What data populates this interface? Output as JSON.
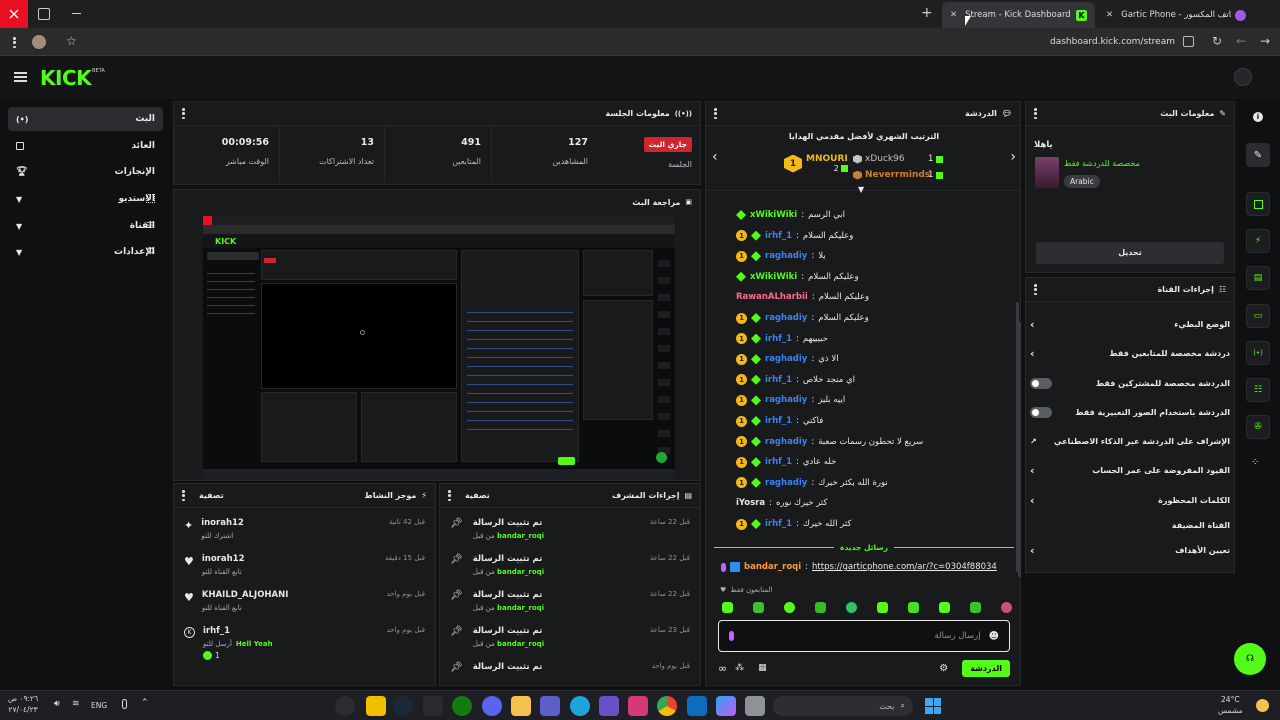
{
  "browser": {
    "tabs": [
      {
        "title": "Stream - Kick Dashboard",
        "active": true
      },
      {
        "title": "Gartic Phone - الهاتف المكسور",
        "active": false
      }
    ],
    "url": "dashboard.kick.com/stream"
  },
  "topbar": {
    "logo": "KICK",
    "beta": "BETA"
  },
  "sidebar": {
    "items": [
      {
        "label": "البث",
        "icon": "broadcast-icon",
        "active": true
      },
      {
        "label": "العائد",
        "icon": "revenue-icon",
        "active": false
      },
      {
        "label": "الإنجازات",
        "icon": "trophy-icon",
        "active": false
      },
      {
        "label": "الاستديو",
        "icon": "studio-icon",
        "active": false
      },
      {
        "label": "القناة",
        "icon": "channel-icon",
        "active": false
      },
      {
        "label": "الإعدادات",
        "icon": "gear-icon",
        "active": false
      }
    ]
  },
  "session": {
    "title": "معلومات الجلسة",
    "live_badge": "جاري البث",
    "session_label": "الجلسة",
    "stats": [
      {
        "value": "127",
        "label": "المشاهدين"
      },
      {
        "value": "491",
        "label": "المتابعين"
      },
      {
        "value": "13",
        "label": "تعداد الاشتراكات"
      },
      {
        "value": "00:09:56",
        "label": "الوقت مباشر"
      }
    ]
  },
  "preview": {
    "title": "مراجعة البث"
  },
  "activity": {
    "title": "موجز النشاط",
    "filter": "تصفية",
    "items": [
      {
        "name": "inorah12",
        "sub": "اشترك للتو",
        "time": "قبل 42 ثانية",
        "icon": "sparkle-icon"
      },
      {
        "name": "inorah12",
        "sub": "تابع القناة للتو",
        "time": "قبل 15 دقيقة",
        "icon": "heart-icon"
      },
      {
        "name": "KHAILD_ALJOHANI",
        "sub": "تابع القناة للتو",
        "time": "قبل يوم واحد",
        "icon": "heart-icon"
      },
      {
        "name": "irhf_1",
        "sub": "أرسل للتو",
        "extra": "Hell Yeah",
        "count": "1",
        "time": "قبل يوم واحد",
        "icon": "kick-icon"
      }
    ]
  },
  "mod": {
    "title": "إجراءات المشرف",
    "filter": "تصفية",
    "items": [
      {
        "action": "تم تثبيت الرسالة",
        "by": "من قبل",
        "user": "bandar_roqi",
        "time": "قبل 22 ساعة"
      },
      {
        "action": "تم تثبيت الرسالة",
        "by": "من قبل",
        "user": "bandar_roqi",
        "time": "قبل 22 ساعة"
      },
      {
        "action": "تم تثبيت الرسالة",
        "by": "من قبل",
        "user": "bandar_roqi",
        "time": "قبل 22 ساعة"
      },
      {
        "action": "تم تثبيت الرسالة",
        "by": "من قبل",
        "user": "bandar_roqi",
        "time": "قبل 23 ساعة"
      },
      {
        "action": "تم تثبيت الرسالة",
        "by": "",
        "user": "",
        "time": "قبل يوم واحد"
      }
    ]
  },
  "chat": {
    "title": "الدردشة",
    "leaderboard_title": "الترتيب الشهري لأفضل مقدمي الهدايا",
    "leaders": [
      {
        "name": "MNOURI",
        "count": "2"
      },
      {
        "name": "xDuck96",
        "count": "1"
      },
      {
        "name": "Neverrminds",
        "count": "1"
      }
    ],
    "messages": [
      {
        "user": "xWikiWiki",
        "text": "ابي الرسم",
        "color": "#53fc18",
        "badges": "gem"
      },
      {
        "user": "irhf_1",
        "text": "وعليكم السلام",
        "color": "#3b82f6",
        "badges": "both"
      },
      {
        "user": "raghadiy",
        "text": "يلا",
        "color": "#3b82f6",
        "badges": "both"
      },
      {
        "user": "xWikiWiki",
        "text": "وعليكم السلام",
        "color": "#53fc18",
        "badges": "gem"
      },
      {
        "user": "RawanALharbii",
        "text": "وعليكم السلام",
        "color": "#ff6b8a",
        "badges": "none"
      },
      {
        "user": "raghadiy",
        "text": "وعليكم السلام",
        "color": "#3b82f6",
        "badges": "both"
      },
      {
        "user": "irhf_1",
        "text": "حبيييهم",
        "color": "#3b82f6",
        "badges": "both"
      },
      {
        "user": "raghadiy",
        "text": "الا ذي",
        "color": "#3b82f6",
        "badges": "both"
      },
      {
        "user": "irhf_1",
        "text": "اي منجد خلاص",
        "color": "#3b82f6",
        "badges": "both"
      },
      {
        "user": "raghadiy",
        "text": "اييه بليز",
        "color": "#3b82f6",
        "badges": "both"
      },
      {
        "user": "irhf_1",
        "text": "فاكتي",
        "color": "#3b82f6",
        "badges": "both"
      },
      {
        "user": "raghadiy",
        "text": "سريع لا تحطون رسمات صعبة",
        "color": "#3b82f6",
        "badges": "both"
      },
      {
        "user": "irhf_1",
        "text": "خله عادي",
        "color": "#3b82f6",
        "badges": "both"
      },
      {
        "user": "raghadiy",
        "text": "نورة الله يكثر خيرك",
        "color": "#3b82f6",
        "badges": "both"
      },
      {
        "user": "iYosra",
        "text": "كثر خيرك نوره",
        "color": "#e8e8e8",
        "badges": "none"
      },
      {
        "user": "irhf_1",
        "text": "كثر الله خيرك",
        "color": "#3b82f6",
        "badges": "both"
      }
    ],
    "new_messages": "رسائل جديدة",
    "pinned_user": "bandar_roqi",
    "pinned_link": "https://garticphone.com/ar/?c=0304f88034",
    "followers_only": "المتابعون فقط",
    "input_placeholder": "إرسال رسالة",
    "send_label": "الدردشة"
  },
  "stream_info": {
    "title": "معلومات البث",
    "greeting": "ياهلا",
    "description": "مخصصة للدردشة فقط",
    "language": "Arabic",
    "edit_button": "تحديل"
  },
  "channel_actions": {
    "title": "إجراءات القناة",
    "items": [
      {
        "label": "الوضع البطيء",
        "control": "chevron"
      },
      {
        "label": "دردشة مخصصة للمتابعين فقط",
        "control": "chevron"
      },
      {
        "label": "الدردشة مخصصة للمشتركين فقط",
        "control": "toggle"
      },
      {
        "label": "الدردشة باستخدام الصور التعبيرية فقط",
        "control": "toggle"
      },
      {
        "label": "الإشراف على الدردشة عبر الذكاء الاصطناعي",
        "control": "external"
      },
      {
        "label": "القيود المفروضة على عمر الحساب",
        "control": "chevron"
      },
      {
        "label": "الكلمات المحظورة",
        "control": "chevron"
      },
      {
        "label": "القناة المضيفة",
        "control": "none"
      },
      {
        "label": "تعيين الأهداف",
        "control": "chevron"
      }
    ]
  },
  "taskbar": {
    "time": "٠٩:٢٦ ص",
    "date": "٢٧/٠٤/٢٣",
    "lang": "ENG",
    "search": "بحث",
    "weather_temp": "24°C",
    "weather_desc": "مشمس"
  },
  "colors": {
    "accent": "#53fc18",
    "bg": "#0f1012",
    "panel": "#181a1c",
    "close": "#e81123"
  }
}
